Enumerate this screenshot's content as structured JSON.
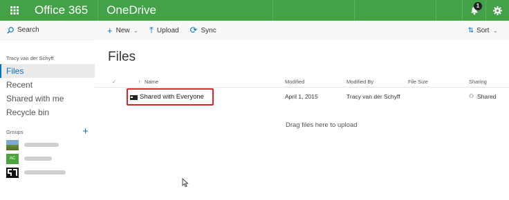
{
  "suite": {
    "brand": "Office 365",
    "app_name": "OneDrive",
    "notification_count": "1",
    "color": "#43a247"
  },
  "sidebar": {
    "search_label": "Search",
    "owner": "Tracy van der Schyff",
    "nav": [
      {
        "label": "Files",
        "active": true
      },
      {
        "label": "Recent"
      },
      {
        "label": "Shared with me"
      },
      {
        "label": "Recycle bin"
      }
    ],
    "groups_label": "Groups",
    "groups": [
      {
        "thumb": "",
        "color": "#6a8f3a"
      },
      {
        "thumb": "AC",
        "color": "#4aa53c"
      },
      {
        "thumb": "",
        "color": "#111111"
      }
    ]
  },
  "commands": {
    "new": "New",
    "upload": "Upload",
    "sync": "Sync",
    "sort": "Sort"
  },
  "main": {
    "title": "Files",
    "columns": {
      "name": "Name",
      "modified": "Modified",
      "modified_by": "Modified By",
      "file_size": "File Size",
      "sharing": "Sharing"
    },
    "rows": [
      {
        "name": "Shared with Everyone",
        "modified": "April 1, 2015",
        "modified_by": "Tracy van der Schyff",
        "file_size": "",
        "sharing": "Shared"
      }
    ],
    "drop_hint": "Drag files here to upload"
  },
  "accent_color": "#0072c6",
  "highlight_color": "#d92626"
}
